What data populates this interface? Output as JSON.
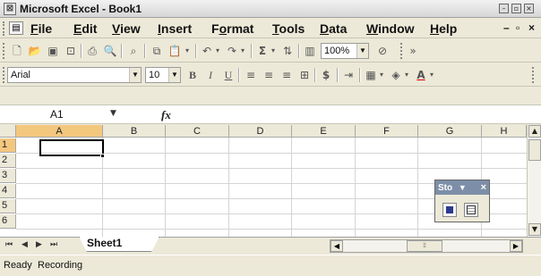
{
  "title": "Microsoft Excel - Book1",
  "menu": [
    "File",
    "Edit",
    "View",
    "Insert",
    "Format",
    "Tools",
    "Data",
    "Window",
    "Help"
  ],
  "menu_underlines": [
    "F",
    "E",
    "V",
    "I",
    "o",
    "T",
    "D",
    "W",
    "H"
  ],
  "toolbar": {
    "zoom": "100%",
    "font": "Arial",
    "size": "10"
  },
  "namebox": "A1",
  "fx": "fx",
  "columns": [
    "A",
    "B",
    "C",
    "D",
    "E",
    "F",
    "G",
    "H"
  ],
  "rows": [
    "1",
    "2",
    "3",
    "4",
    "5",
    "6"
  ],
  "sheet_tab": "Sheet1",
  "status": {
    "ready": "Ready",
    "recording": "Recording"
  },
  "stop_recording": {
    "title": "Sto",
    "close": "×"
  },
  "colors": {
    "selected_header": "#f4c77f",
    "chrome": "#ece9d8"
  }
}
